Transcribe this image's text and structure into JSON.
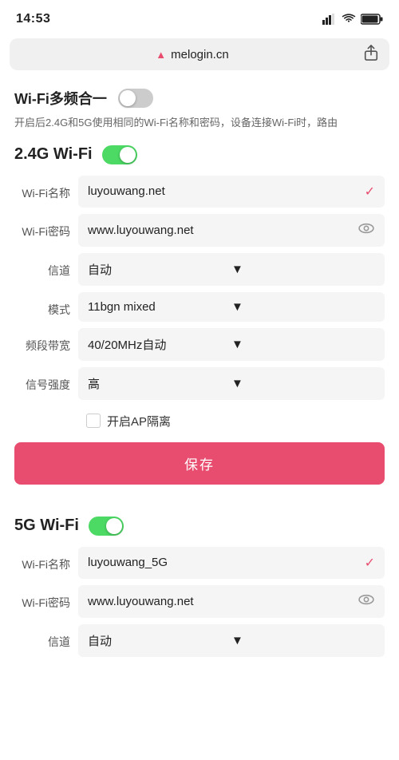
{
  "statusBar": {
    "time": "14:53",
    "hasSignal": true,
    "hasWifi": true,
    "hasBattery": true
  },
  "addressBar": {
    "icon": "▲",
    "url": "melogin.cn"
  },
  "multiband": {
    "title": "Wi-Fi多频合一",
    "toggleState": "off",
    "description": "开启后2.4G和5G使用相同的Wi-Fi名称和密码，设备连接Wi-Fi时，路由"
  },
  "wifi24": {
    "title": "2.4G Wi-Fi",
    "toggleState": "on",
    "fields": {
      "nameLabel": "Wi-Fi名称",
      "nameValue": "luyouwang.net",
      "passwordLabel": "Wi-Fi密码",
      "passwordValue": "www.luyouwang.net",
      "channelLabel": "信道",
      "channelValue": "自动",
      "modeLabel": "模式",
      "modeValue": "11bgn mixed",
      "bandwidthLabel": "频段带宽",
      "bandwidthValue": "40/20MHz自动",
      "signalLabel": "信号强度",
      "signalValue": "高",
      "apIsolationLabel": "开启AP隔离"
    },
    "saveButton": "保存"
  },
  "wifi5g": {
    "title": "5G Wi-Fi",
    "toggleState": "on",
    "fields": {
      "nameLabel": "Wi-Fi名称",
      "nameValue": "luyouwang_5G",
      "passwordLabel": "Wi-Fi密码",
      "passwordValue": "www.luyouwang.net",
      "channelLabel": "信道",
      "channelValue": "自动"
    }
  }
}
